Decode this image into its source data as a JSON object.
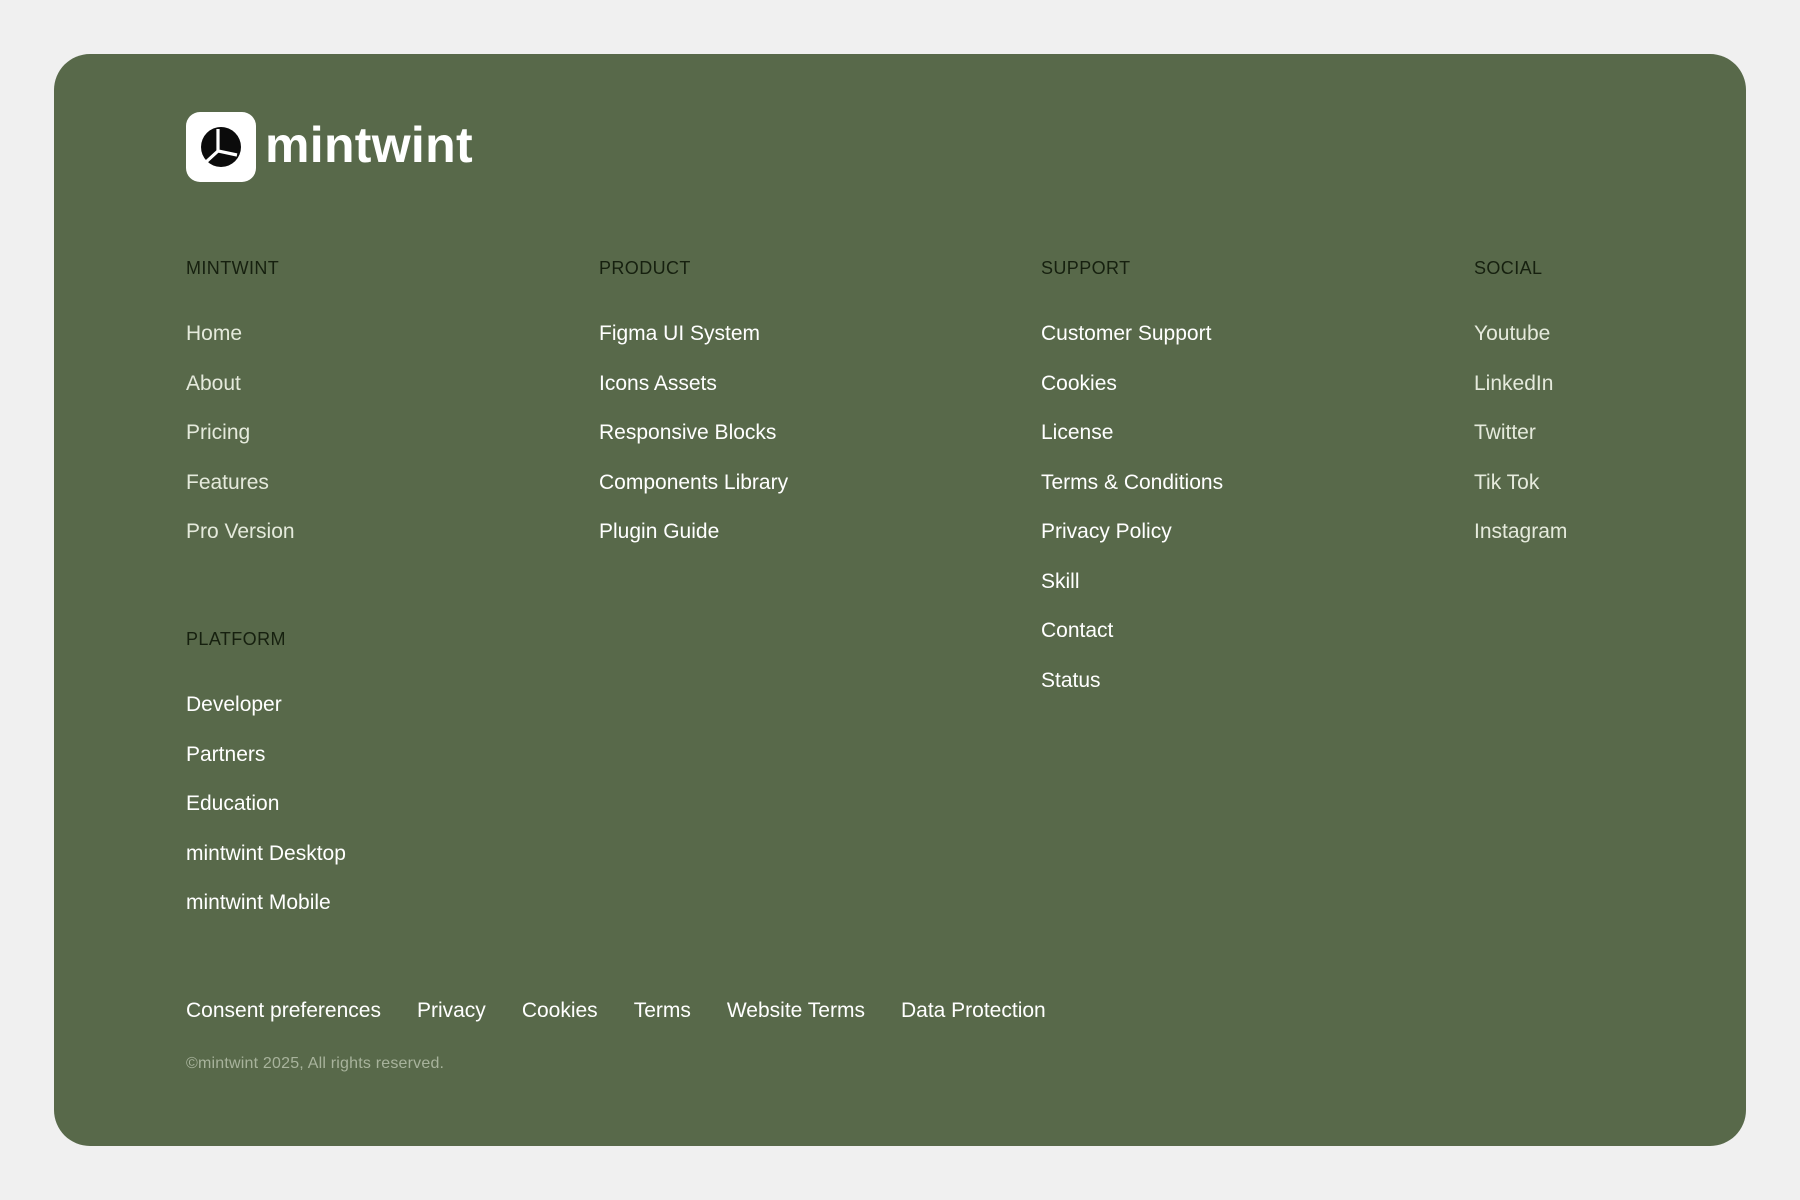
{
  "brand": {
    "name": "mintwint",
    "icon": "mintwint-logo-icon"
  },
  "columns": {
    "mintwint": {
      "heading": "MINTWINT",
      "links": [
        "Home",
        "About",
        "Pricing",
        "Features",
        "Pro Version"
      ]
    },
    "platform": {
      "heading": "PLATFORM",
      "links": [
        "Developer",
        "Partners",
        "Education",
        "mintwint Desktop",
        "mintwint Mobile"
      ]
    },
    "product": {
      "heading": "PRODUCT",
      "links": [
        "Figma UI System",
        "Icons Assets",
        "Responsive Blocks",
        "Components Library",
        "Plugin Guide"
      ]
    },
    "support": {
      "heading": "SUPPORT",
      "links": [
        "Customer Support",
        "Cookies",
        "License",
        "Terms & Conditions",
        "Privacy Policy",
        "Skill",
        "Contact",
        "Status"
      ]
    },
    "social": {
      "heading": "SOCIAL",
      "links": [
        "Youtube",
        "LinkedIn",
        "Twitter",
        "Tik Tok",
        "Instagram"
      ]
    }
  },
  "legal_links": [
    "Consent preferences",
    "Privacy",
    "Cookies",
    "Terms",
    "Website Terms",
    "Data Protection"
  ],
  "copyright": "©mintwint 2025, All rights reserved.",
  "colors": {
    "page_background": "#f0f0f0",
    "footer_background": "#58694a",
    "heading_text": "#16200f",
    "link_text": "#ffffff",
    "copyright_text": "#a8b39c"
  }
}
